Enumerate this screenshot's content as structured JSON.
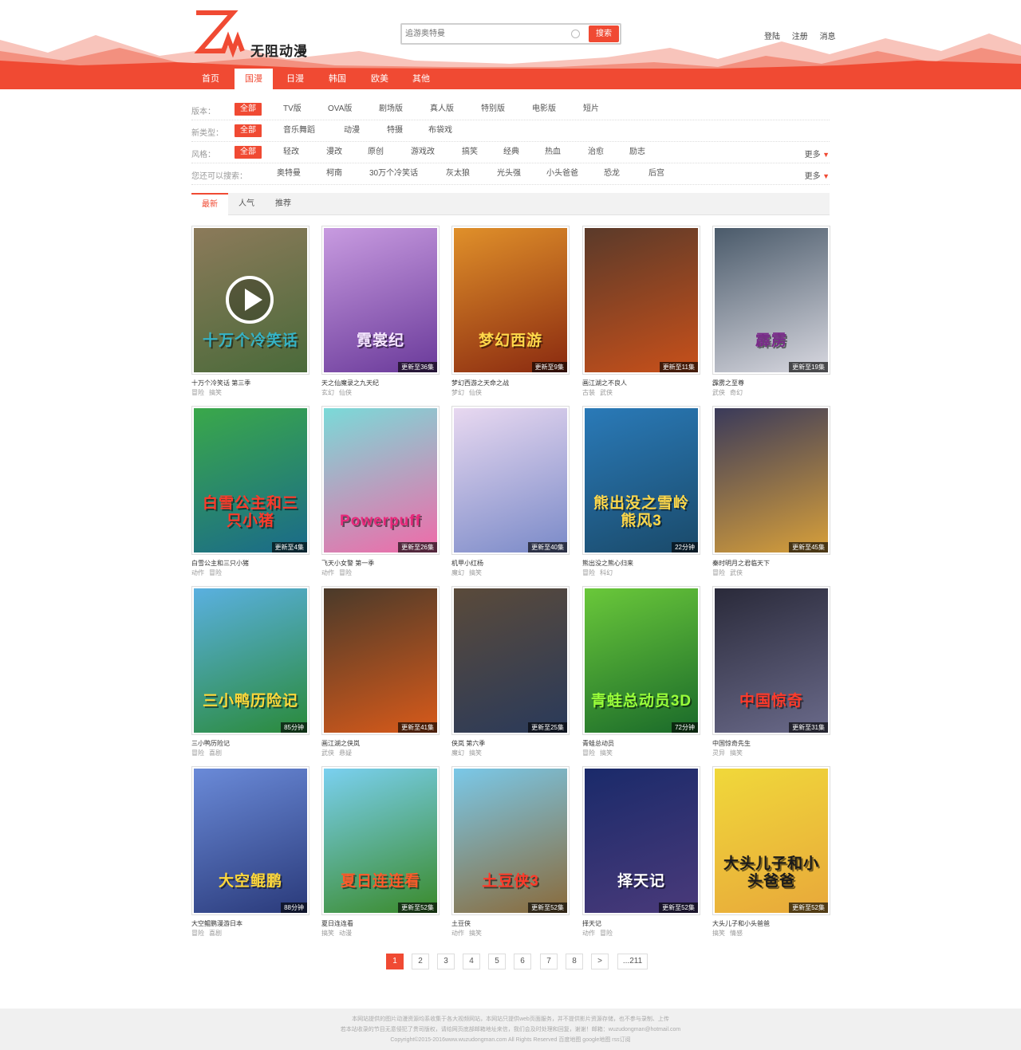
{
  "brand": {
    "name": "无阻动漫",
    "accent_color": "#f04a33"
  },
  "search": {
    "placeholder": "追游奥特曼",
    "button_label": "搜索",
    "icon": "search-icon"
  },
  "user_links": {
    "login": "登陆",
    "register": "注册",
    "messages": "消息"
  },
  "nav": [
    {
      "label": "首页",
      "active": false
    },
    {
      "label": "国漫",
      "active": true
    },
    {
      "label": "日漫",
      "active": false
    },
    {
      "label": "韩国",
      "active": false
    },
    {
      "label": "欧美",
      "active": false
    },
    {
      "label": "其他",
      "active": false
    }
  ],
  "filters": [
    {
      "label": "版本：",
      "options": [
        "全部",
        "TV版",
        "OVA版",
        "剧场版",
        "真人版",
        "特别版",
        "电影版",
        "短片"
      ],
      "active": 0,
      "more": ""
    },
    {
      "label": "新类型：",
      "options": [
        "全部",
        "音乐舞蹈",
        "动漫",
        "特摄",
        "布袋戏"
      ],
      "active": 0,
      "more": ""
    },
    {
      "label": "风格：",
      "options": [
        "全部",
        "轻改",
        "漫改",
        "原创",
        "游戏改",
        "搞笑",
        "经典",
        "热血",
        "治愈",
        "励志"
      ],
      "active": 0,
      "more": "更多"
    },
    {
      "label": "您还可以搜索：",
      "options": [
        "奥特曼",
        "柯南",
        "30万个冷笑话",
        "灰太狼",
        "光头强",
        "小头爸爸",
        "恐龙",
        "后宫"
      ],
      "active": -1,
      "more": "更多"
    }
  ],
  "tabs": [
    {
      "label": "最新",
      "active": true
    },
    {
      "label": "人气",
      "active": false
    },
    {
      "label": "推荐",
      "active": false
    }
  ],
  "cards": [
    {
      "name": "十万个冷笑话 第三季",
      "tags": [
        "冒险",
        "搞笑"
      ],
      "badge": "",
      "title": "十万个冷笑话",
      "colors": [
        "#8c7a5a",
        "#4a6a3a"
      ],
      "title_color": "#35b3c6"
    },
    {
      "name": "天之仙魔录之九天纪",
      "tags": [
        "玄幻",
        "仙侠"
      ],
      "badge": "更新至36集",
      "title": "霓裳纪",
      "colors": [
        "#c89be0",
        "#6a3a9a"
      ],
      "title_color": "#f5e6ff"
    },
    {
      "name": "梦幻西游之天命之战",
      "tags": [
        "梦幻",
        "仙侠"
      ],
      "badge": "更新至9集",
      "title": "梦幻西游",
      "colors": [
        "#e0902a",
        "#8a2a10"
      ],
      "title_color": "#ffd84a"
    },
    {
      "name": "画江湖之不良人",
      "tags": [
        "古装",
        "武侠"
      ],
      "badge": "更新至11集",
      "title": "",
      "colors": [
        "#5a3a2a",
        "#c8501a"
      ],
      "title_color": "#ffcc66"
    },
    {
      "name": "霹雳之至尊",
      "tags": [
        "武侠",
        "奇幻"
      ],
      "badge": "更新至19集",
      "title": "霹雳",
      "colors": [
        "#4a5a6a",
        "#d8d8e0"
      ],
      "title_color": "#7a2a8a"
    },
    {
      "name": "白雪公主和三只小猪",
      "tags": [
        "动作",
        "冒险"
      ],
      "badge": "更新至4集",
      "title": "白雪公主和三只小猪",
      "colors": [
        "#3aa84a",
        "#1a6a8a"
      ],
      "title_color": "#ff3a2a"
    },
    {
      "name": "飞天小女警 第一季",
      "tags": [
        "动作",
        "冒险"
      ],
      "badge": "更新至26集",
      "title": "Powerpuff",
      "colors": [
        "#7adad8",
        "#f06aa8"
      ],
      "title_color": "#e8287a"
    },
    {
      "name": "机甲小红杨",
      "tags": [
        "魔幻",
        "搞笑"
      ],
      "badge": "更新至40集",
      "title": "",
      "colors": [
        "#e8d8f0",
        "#7a8ac8"
      ],
      "title_color": "#e83a3a"
    },
    {
      "name": "熊出没之熊心归来",
      "tags": [
        "冒险",
        "科幻"
      ],
      "badge": "22分钟",
      "title": "熊出没之雪岭熊风3",
      "colors": [
        "#2a7ab8",
        "#1a4a6a"
      ],
      "title_color": "#ffd84a"
    },
    {
      "name": "秦时明月之君临天下",
      "tags": [
        "冒险",
        "武侠"
      ],
      "badge": "更新至45集",
      "title": "",
      "colors": [
        "#3a3a5a",
        "#d8a03a"
      ],
      "title_color": "#ffd84a"
    },
    {
      "name": "三小鸭历险记",
      "tags": [
        "冒险",
        "喜剧"
      ],
      "badge": "85分钟",
      "title": "三小鸭历险记",
      "colors": [
        "#5ab0e0",
        "#2a8a3a"
      ],
      "title_color": "#ffd83a"
    },
    {
      "name": "画江湖之侠岚",
      "tags": [
        "武侠",
        "悬疑"
      ],
      "badge": "更新至41集",
      "title": "",
      "colors": [
        "#4a3a2a",
        "#d85a1a"
      ],
      "title_color": "#ffaa33"
    },
    {
      "name": "侠岚 第六季",
      "tags": [
        "魔幻",
        "搞笑"
      ],
      "badge": "更新至25集",
      "title": "",
      "colors": [
        "#5a4a3a",
        "#2a3a5a"
      ],
      "title_color": "#ffcc66"
    },
    {
      "name": "青蛙总动员",
      "tags": [
        "冒险",
        "搞笑"
      ],
      "badge": "72分钟",
      "title": "青蛙总动员3D",
      "colors": [
        "#6ac83a",
        "#1a6a2a"
      ],
      "title_color": "#9aff3a"
    },
    {
      "name": "中国惊奇先生",
      "tags": [
        "灵异",
        "搞笑"
      ],
      "badge": "更新至31集",
      "title": "中国惊奇",
      "colors": [
        "#2a2a3a",
        "#6a6a8a"
      ],
      "title_color": "#ff3a2a"
    },
    {
      "name": "大空鲲鹏漫游日本",
      "tags": [
        "冒险",
        "喜剧"
      ],
      "badge": "88分钟",
      "title": "大空鲲鹏",
      "colors": [
        "#6a8ad8",
        "#2a3a7a"
      ],
      "title_color": "#ffd83a"
    },
    {
      "name": "夏日连连看",
      "tags": [
        "搞笑",
        "动漫"
      ],
      "badge": "更新至52集",
      "title": "夏日连连看",
      "colors": [
        "#7ad0f0",
        "#3a8a2a"
      ],
      "title_color": "#ff5a2a"
    },
    {
      "name": "土豆侠",
      "tags": [
        "动作",
        "搞笑"
      ],
      "badge": "更新至52集",
      "title": "土豆侠3",
      "colors": [
        "#7ac8e8",
        "#8a6a3a"
      ],
      "title_color": "#ff3a2a"
    },
    {
      "name": "择天记",
      "tags": [
        "动作",
        "冒险"
      ],
      "badge": "更新至52集",
      "title": "择天记",
      "colors": [
        "#1a2a6a",
        "#4a3a7a"
      ],
      "title_color": "#ffffff"
    },
    {
      "name": "大头儿子和小头爸爸",
      "tags": [
        "搞笑",
        "情感"
      ],
      "badge": "更新至52集",
      "title": "大头儿子和小头爸爸",
      "colors": [
        "#f0d83a",
        "#e8a83a"
      ],
      "title_color": "#1a1a1a"
    }
  ],
  "pagination": {
    "pages": [
      "1",
      "2",
      "3",
      "4",
      "5",
      "6",
      "7",
      "8",
      ">",
      "...211"
    ],
    "active": 0
  },
  "footer": {
    "line1": "本网站提供的图片动漫资源均系收集于各大视频网站，本网站只提供web页面服务，并不提供影片资源存储，也不参与录制、上传",
    "line2": "若本站收录的节目无意侵犯了贵司版权，请给网页底部邮箱地址来信，我们会及时处理和回复，谢谢！邮箱：wuzudongman@hotmail.com",
    "line3": "Copyright©2015-2016www.wuzudongman.com All Rights Reserved 百度地图 google地图 rss订阅"
  }
}
